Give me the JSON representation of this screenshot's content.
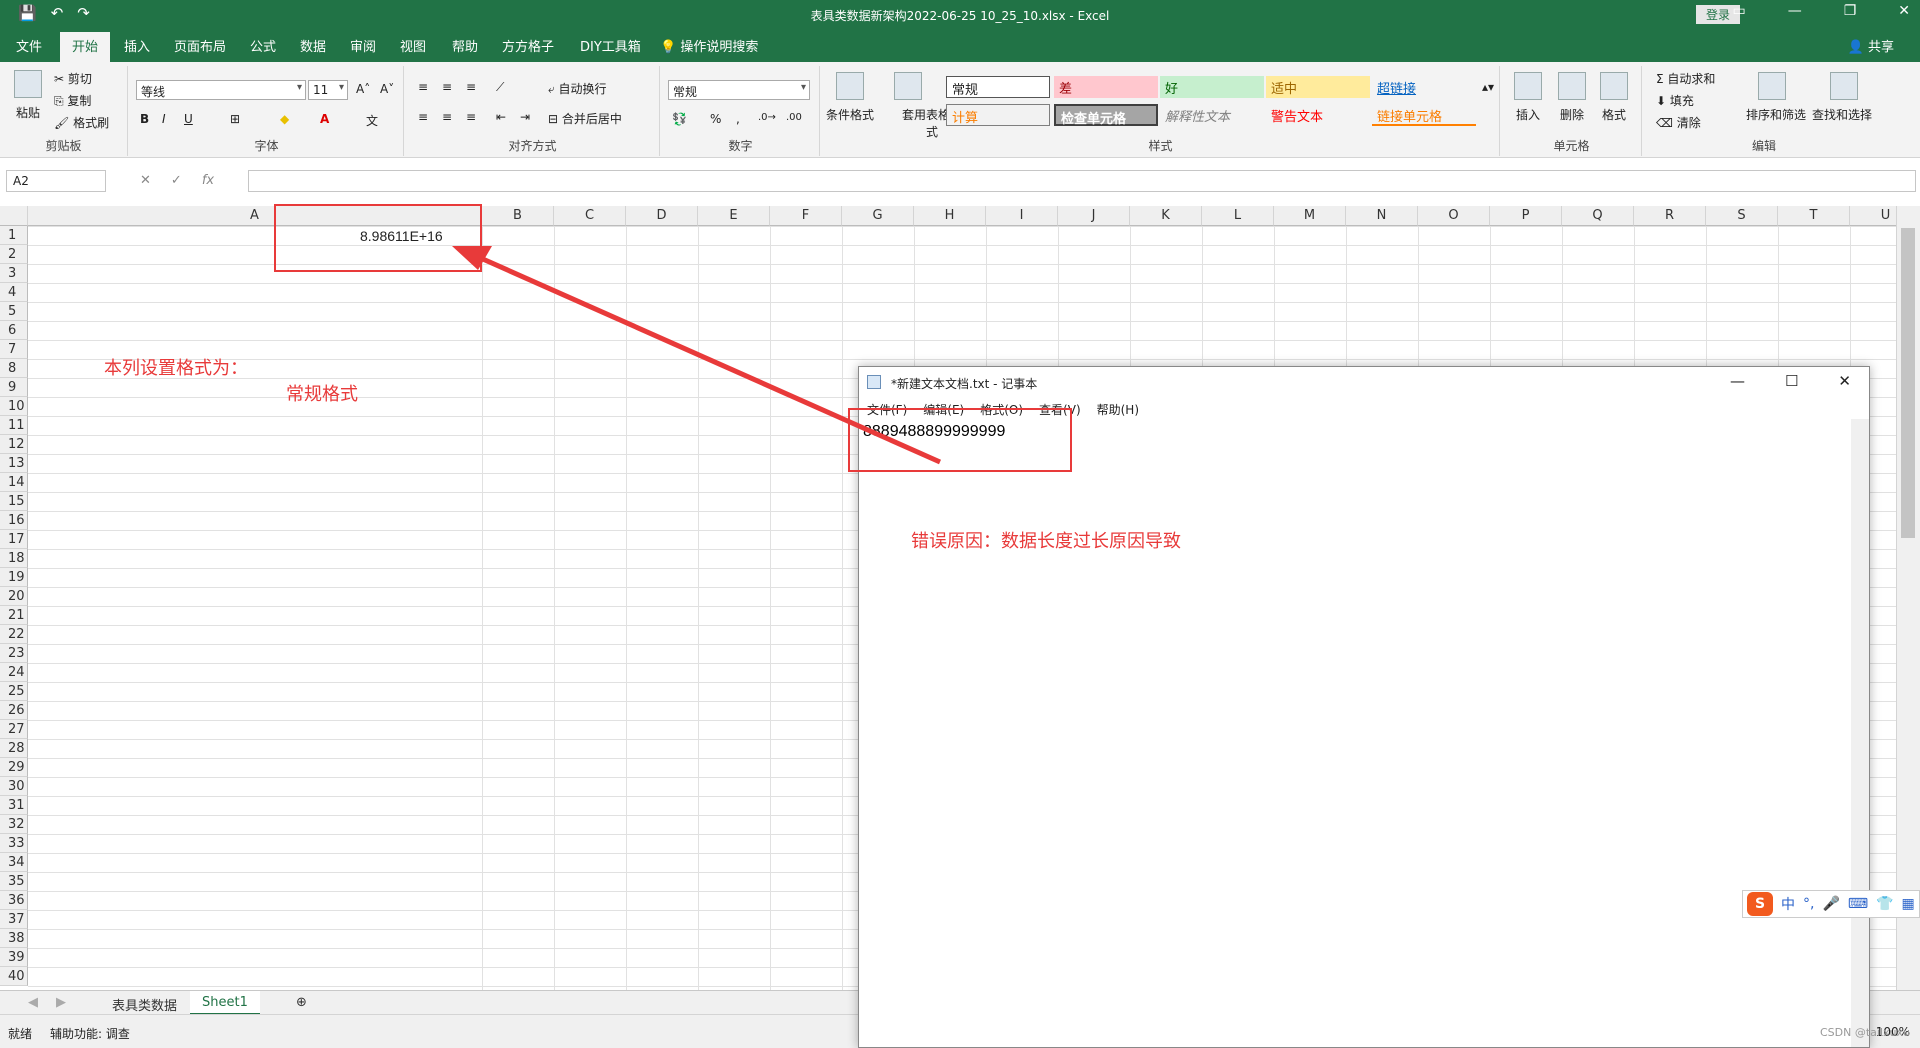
{
  "titlebar": {
    "title": "表具类数据新架构2022-06-25 10_25_10.xlsx  -  Excel",
    "login": "登录",
    "qat": [
      "💾",
      "↶",
      "↷"
    ]
  },
  "tabs": [
    "文件",
    "开始",
    "插入",
    "页面布局",
    "公式",
    "数据",
    "审阅",
    "视图",
    "帮助",
    "方方格子",
    "DIY工具箱"
  ],
  "tellme": "操作说明搜索",
  "share": "共享",
  "ribbon": {
    "clipboard": {
      "label": "剪贴板",
      "paste": "粘贴",
      "cut": "剪切",
      "copy": "复制",
      "format_painter": "格式刷"
    },
    "font": {
      "label": "字体",
      "name": "等线",
      "size": "11",
      "bold": "B",
      "italic": "I",
      "underline": "U"
    },
    "align": {
      "label": "对齐方式",
      "wrap": "自动换行",
      "merge": "合并后居中"
    },
    "number": {
      "label": "数字",
      "format": "常规",
      "percent": "%"
    },
    "styles": {
      "label": "样式",
      "cond_format": "条件格式",
      "table_format": "套用表格格式",
      "cells": [
        "常规",
        "差",
        "好",
        "适中",
        "超链接",
        "计算",
        "检查单元格",
        "解释性文本",
        "警告文本",
        "链接单元格"
      ]
    },
    "cells": {
      "label": "单元格",
      "insert": "插入",
      "delete": "删除",
      "format": "格式"
    },
    "editing": {
      "label": "编辑",
      "autosum": "自动求和",
      "fill": "填充",
      "clear": "清除",
      "sort": "排序和筛选",
      "find": "查找和选择"
    }
  },
  "formula_bar": {
    "name_box": "A2",
    "fx": "fx",
    "value": ""
  },
  "grid": {
    "columns": [
      "A",
      "B",
      "C",
      "D",
      "E",
      "F",
      "G",
      "H",
      "I",
      "J",
      "K",
      "L",
      "M",
      "N",
      "O",
      "P",
      "Q",
      "R",
      "S",
      "T",
      "U"
    ],
    "rows": [
      "1",
      "2",
      "3",
      "4",
      "5",
      "6",
      "7",
      "8",
      "9",
      "10",
      "11",
      "12",
      "13",
      "14",
      "15",
      "16",
      "17",
      "18",
      "19",
      "20",
      "21",
      "22",
      "23",
      "24",
      "25",
      "26",
      "27",
      "28",
      "29",
      "30",
      "31",
      "32",
      "33",
      "34",
      "35",
      "36",
      "37",
      "38",
      "39",
      "40"
    ],
    "cell_a1": "8.98611E+16"
  },
  "sheets": {
    "tabs": [
      "表具类数据",
      "Sheet1"
    ],
    "active": "Sheet1",
    "add": "⊕"
  },
  "status": {
    "ready": "就绪",
    "accessibility": "辅助功能: 调查",
    "zoom": "100%"
  },
  "notepad": {
    "title": "*新建文本文档.txt - 记事本",
    "menu": [
      "文件(F)",
      "编辑(E)",
      "格式(O)",
      "查看(V)",
      "帮助(H)"
    ],
    "content": "8889488899999999"
  },
  "annotations": {
    "col_format_1": "本列设置格式为：",
    "col_format_2": "常规格式",
    "reason": "错误原因：数据长度过长原因导致",
    "color": "#e83a3a"
  },
  "ime": {
    "mode": "中"
  },
  "watermark": "CSDN @tailxuxu"
}
